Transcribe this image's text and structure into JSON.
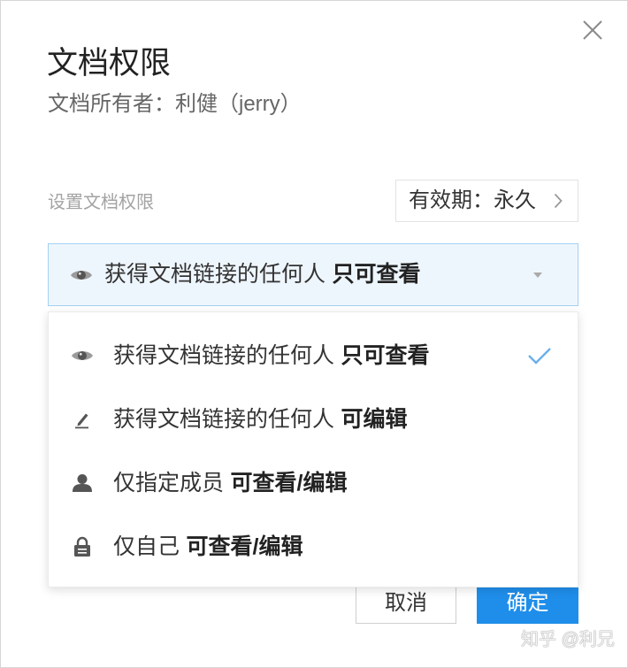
{
  "dialog": {
    "title": "文档权限",
    "owner": "文档所有者：利健（jerry）",
    "close_icon": "close-icon"
  },
  "permission": {
    "section_label": "设置文档权限",
    "validity": {
      "label": "有效期：永久",
      "icon": "chevron-right-icon"
    },
    "select": {
      "icon": "eye-icon",
      "prefix": "获得文档链接的任何人",
      "level": "只可查看",
      "caret_icon": "caret-down-icon"
    },
    "options": [
      {
        "icon": "eye-icon",
        "prefix": "获得文档链接的任何人",
        "level": "只可查看",
        "selected": true
      },
      {
        "icon": "pencil-icon",
        "prefix": "获得文档链接的任何人",
        "level": "可编辑",
        "selected": false
      },
      {
        "icon": "person-icon",
        "prefix": "仅指定成员",
        "level": "可查看/编辑",
        "selected": false
      },
      {
        "icon": "lock-icon",
        "prefix": "仅自己",
        "level": "可查看/编辑",
        "selected": false
      }
    ],
    "selected_icon": "checkmark-icon"
  },
  "footer": {
    "cancel_label": "取消",
    "confirm_label": "确定"
  },
  "watermark": "知乎 @利兄",
  "colors": {
    "accent": "#1f8eea",
    "select_bg": "#eef6fd",
    "select_border": "#a3d0f0",
    "check": "#6cafe9"
  }
}
